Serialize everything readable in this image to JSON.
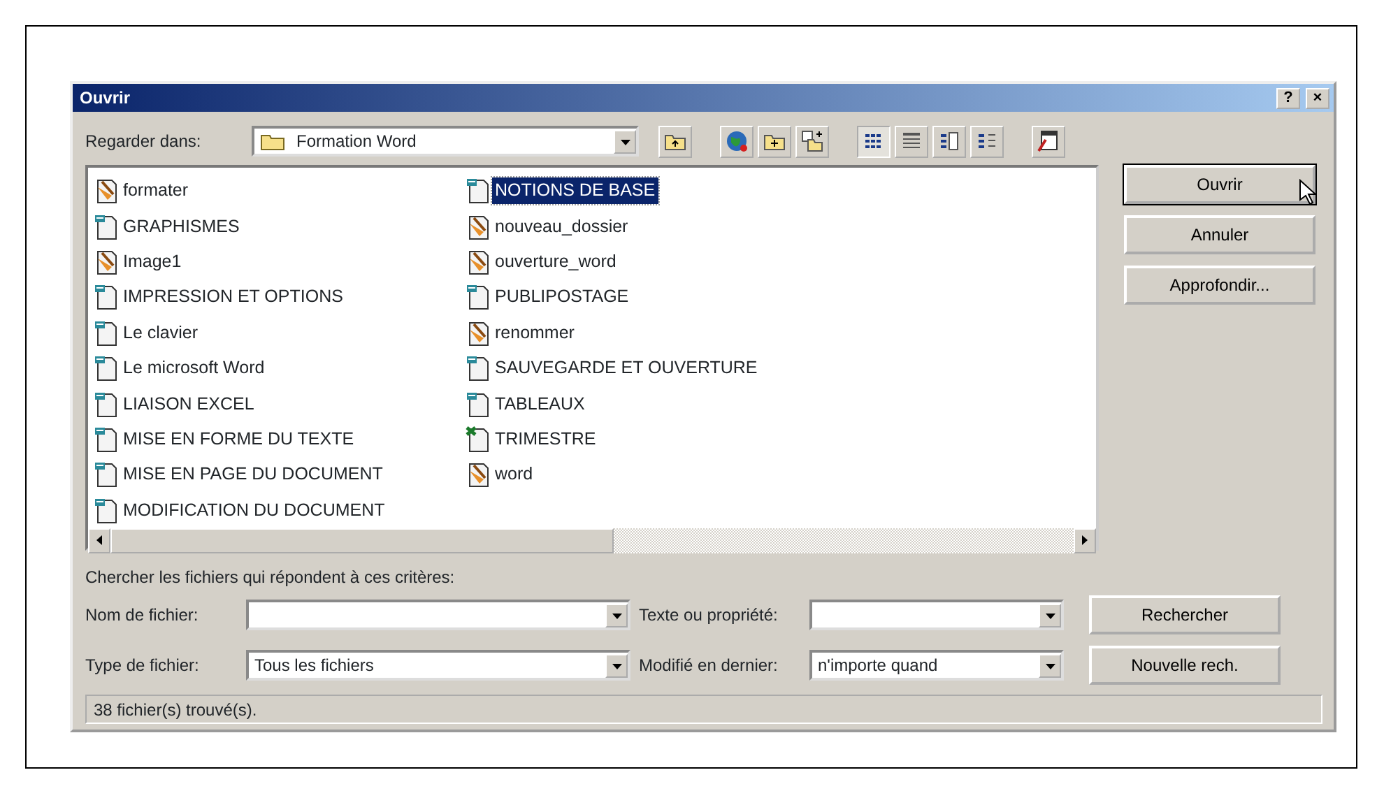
{
  "window": {
    "title": "Ouvrir",
    "help_button": "?",
    "close_button": "×"
  },
  "look_in": {
    "label": "Regarder dans:",
    "value": "Formation Word"
  },
  "view_buttons": [
    {
      "kind": "list",
      "selected": true
    },
    {
      "kind": "details",
      "selected": false
    },
    {
      "kind": "properties",
      "selected": false
    },
    {
      "kind": "preview",
      "selected": false
    }
  ],
  "files": [
    {
      "name": "formater",
      "kind": "image",
      "selected": false
    },
    {
      "name": "GRAPHISMES",
      "kind": "doc",
      "selected": false
    },
    {
      "name": "Image1",
      "kind": "image",
      "selected": false
    },
    {
      "name": "IMPRESSION ET OPTIONS",
      "kind": "doc",
      "selected": false
    },
    {
      "name": "Le clavier",
      "kind": "doc",
      "selected": false
    },
    {
      "name": "Le microsoft Word",
      "kind": "doc",
      "selected": false
    },
    {
      "name": "LIAISON EXCEL",
      "kind": "doc",
      "selected": false
    },
    {
      "name": "MISE EN FORME DU TEXTE",
      "kind": "doc",
      "selected": false
    },
    {
      "name": "MISE EN PAGE DU DOCUMENT",
      "kind": "doc",
      "selected": false
    },
    {
      "name": "MODIFICATION DU DOCUMENT",
      "kind": "doc",
      "selected": false
    },
    {
      "name": "NOTIONS DE BASE",
      "kind": "doc",
      "selected": true
    },
    {
      "name": "nouveau_dossier",
      "kind": "image",
      "selected": false
    },
    {
      "name": "ouverture_word",
      "kind": "image",
      "selected": false
    },
    {
      "name": "PUBLIPOSTAGE",
      "kind": "doc",
      "selected": false
    },
    {
      "name": "renommer",
      "kind": "image",
      "selected": false
    },
    {
      "name": "SAUVEGARDE ET OUVERTURE",
      "kind": "doc",
      "selected": false
    },
    {
      "name": "TABLEAUX",
      "kind": "doc",
      "selected": false
    },
    {
      "name": "TRIMESTRE",
      "kind": "sheet",
      "selected": false
    },
    {
      "name": "word",
      "kind": "image",
      "selected": false
    }
  ],
  "buttons": [
    {
      "label": "Ouvrir",
      "default": true
    },
    {
      "label": "Annuler",
      "default": false
    },
    {
      "label": "Approfondir...",
      "default": false
    }
  ],
  "search": {
    "heading": "Chercher les fichiers qui répondent à ces critères:",
    "fields": [
      {
        "label": "Nom de fichier:"
      },
      {
        "label": "Texte ou propriété:"
      },
      {
        "label": "Type de fichier:",
        "value": "Tous les fichiers"
      },
      {
        "label": "Modifié en dernier:",
        "value": "n'importe quand"
      }
    ],
    "buttons": [
      "Rechercher",
      "Nouvelle rech."
    ]
  },
  "status_bar": "38 fichier(s) trouvé(s)."
}
